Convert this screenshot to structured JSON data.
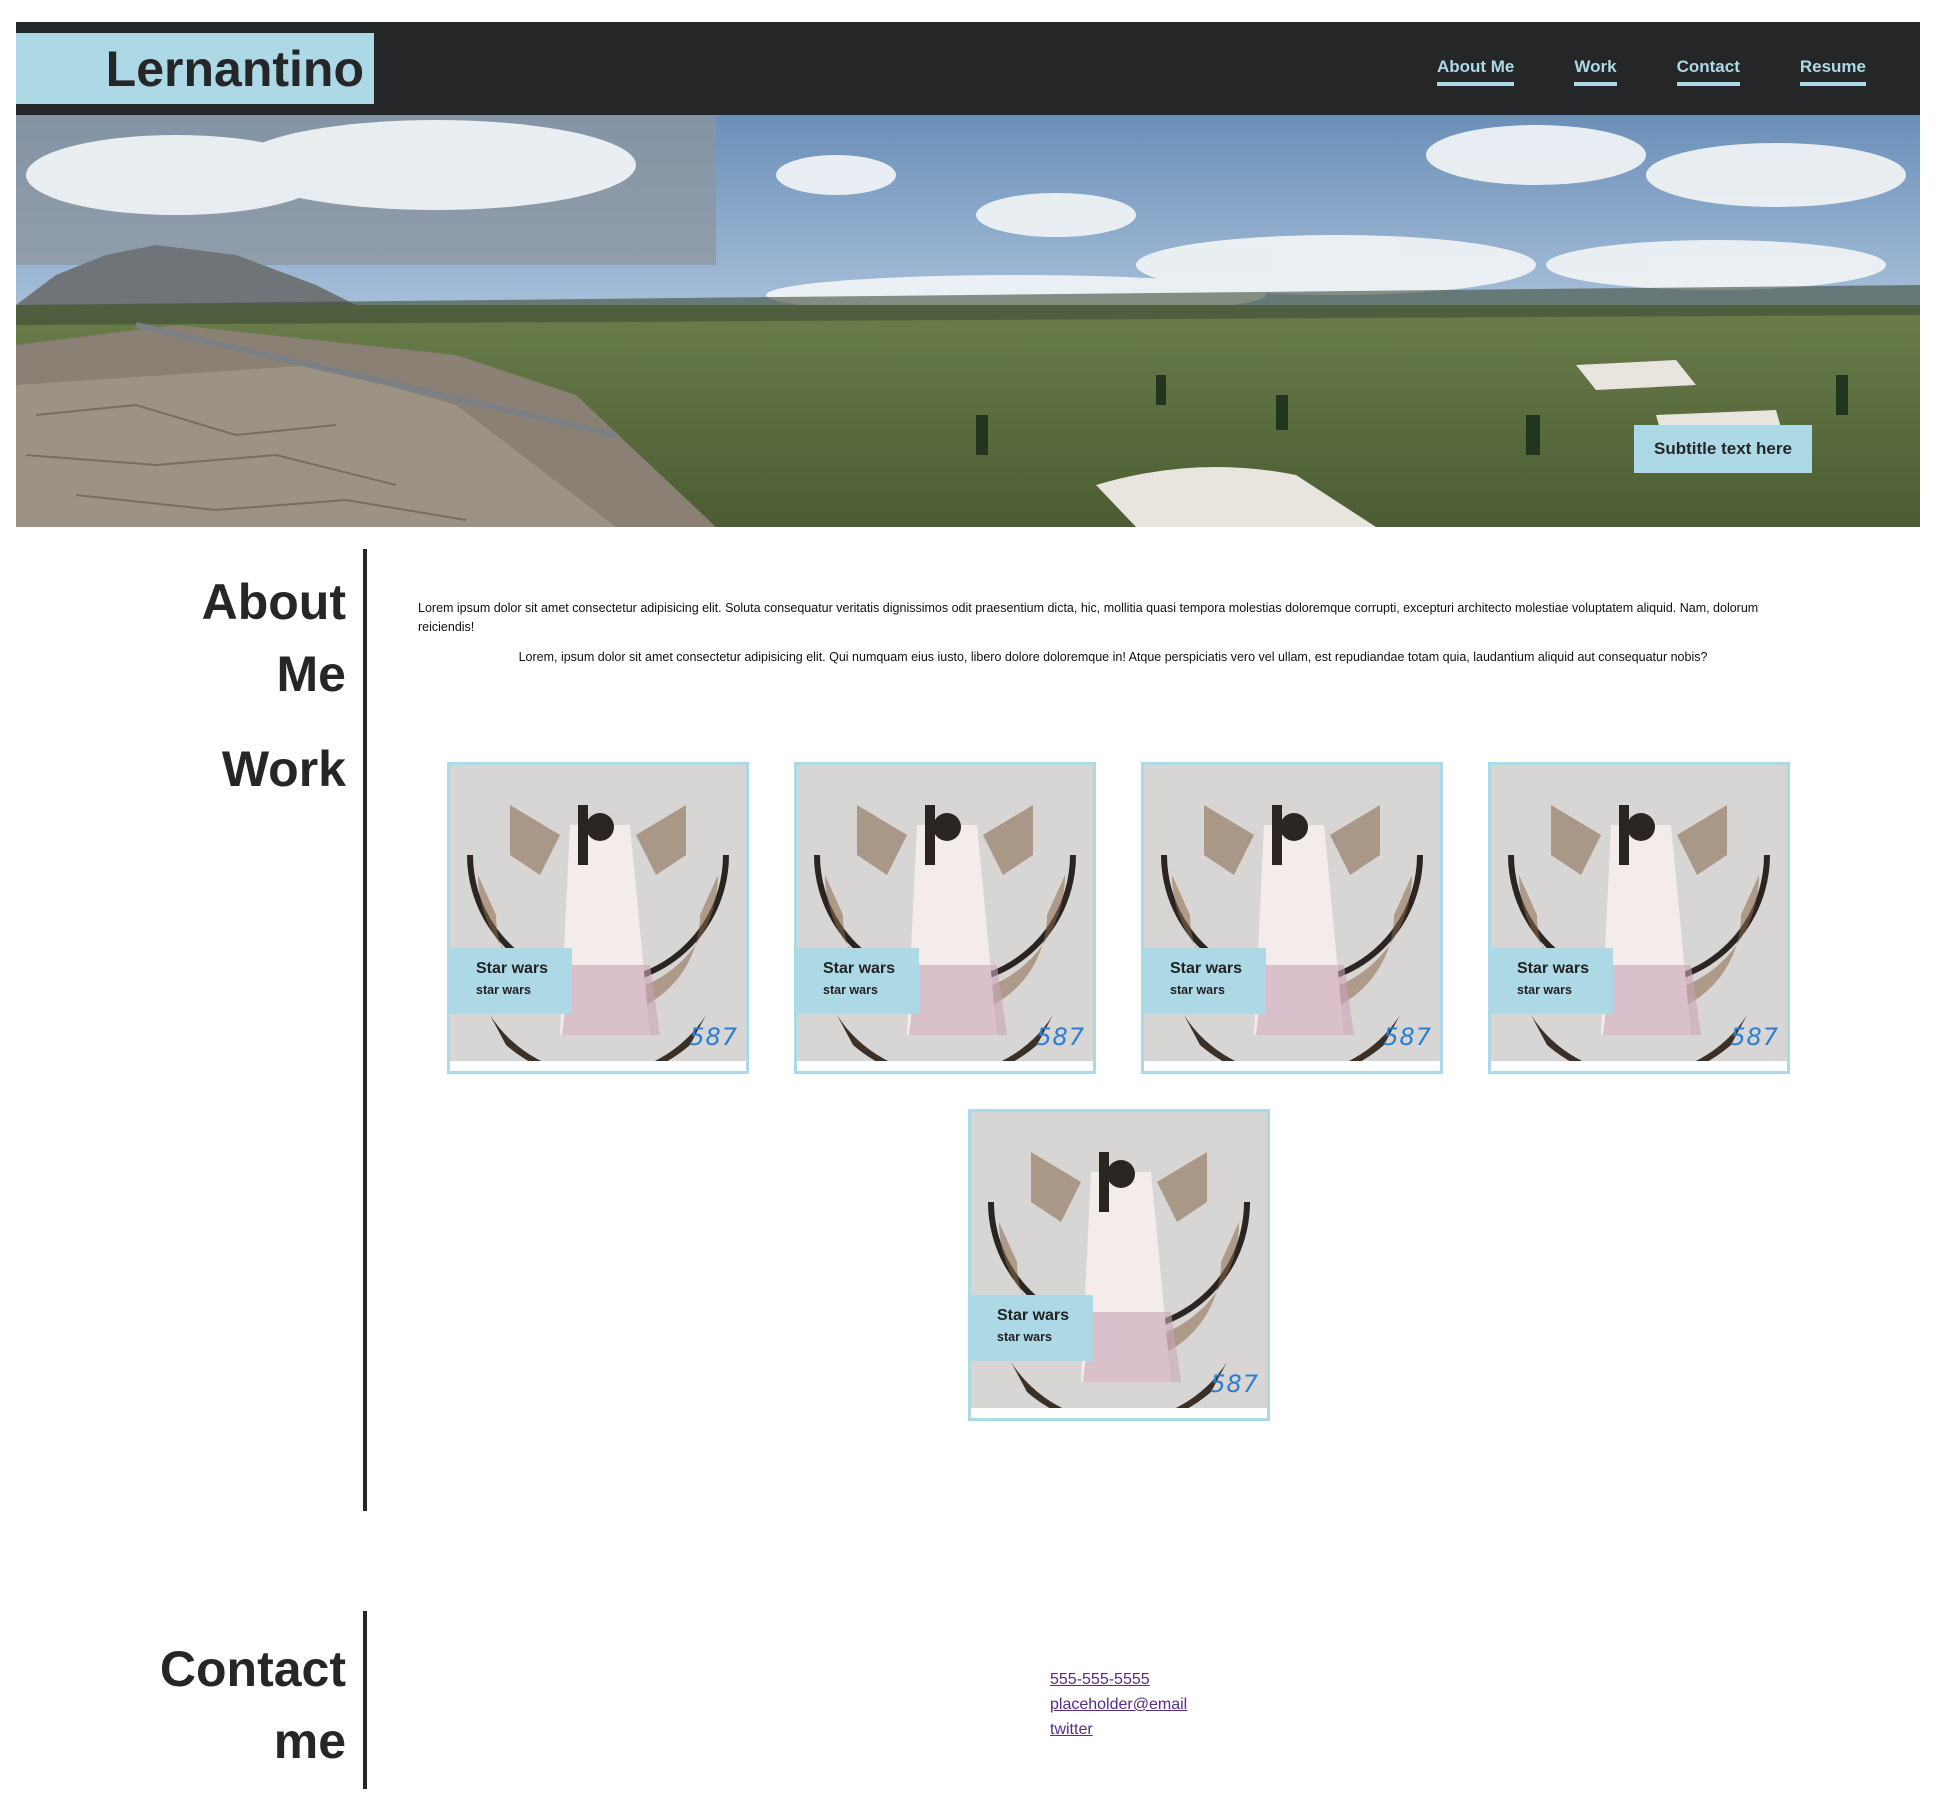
{
  "header": {
    "brand": "Lernantino",
    "nav": [
      {
        "label": "About Me"
      },
      {
        "label": "Work"
      },
      {
        "label": "Contact"
      },
      {
        "label": "Resume"
      }
    ]
  },
  "hero": {
    "subtitle": "Subtitle text here"
  },
  "about": {
    "title_line1": "About",
    "title_line2": "Me",
    "paragraphs": [
      "Lorem ipsum dolor sit amet consectetur adipisicing elit. Soluta consequatur veritatis dignissimos odit praesentium dicta, hic, mollitia quasi tempora molestias doloremque corrupti, excepturi architecto molestiae voluptatem aliquid. Nam, dolorum reiciendis!",
      "Lorem, ipsum dolor sit amet consectetur adipisicing elit. Qui numquam eius iusto, libero dolore doloremque in! Atque perspiciatis vero vel ullam, est repudiandae totam quia, laudantium aliquid aut consequatur nobis?"
    ]
  },
  "work": {
    "title": "Work",
    "cards": [
      {
        "title": "Star wars",
        "subtitle": "star wars",
        "badge": "587"
      },
      {
        "title": "Star wars",
        "subtitle": "star wars",
        "badge": "587"
      },
      {
        "title": "Star wars",
        "subtitle": "star wars",
        "badge": "587"
      },
      {
        "title": "Star wars",
        "subtitle": "star wars",
        "badge": "587"
      },
      {
        "title": "Star wars",
        "subtitle": "star wars",
        "badge": "587"
      }
    ]
  },
  "contact": {
    "title_line1": "Contact",
    "title_line2": "me",
    "links": [
      {
        "label": "555-555-5555"
      },
      {
        "label": "placeholder@email"
      },
      {
        "label": "twitter"
      }
    ]
  },
  "colors": {
    "accent": "#add8e6",
    "dark": "#252627",
    "link_visited": "#5b2c83"
  }
}
